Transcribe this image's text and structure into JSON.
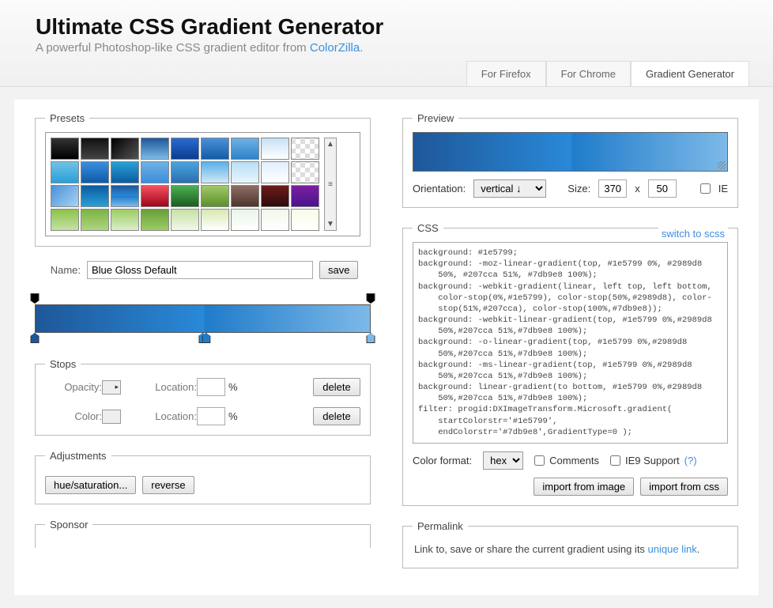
{
  "header": {
    "title": "Ultimate CSS Gradient Generator",
    "tagline_prefix": "A powerful Photoshop-like CSS gradient editor from ",
    "tagline_link": "ColorZilla",
    "tagline_suffix": "."
  },
  "tabs": [
    {
      "label": "For Firefox",
      "active": false
    },
    {
      "label": "For Chrome",
      "active": false
    },
    {
      "label": "Gradient Generator",
      "active": true
    }
  ],
  "presets": {
    "legend": "Presets",
    "swatches": [
      "linear-gradient(#333,#000)",
      "linear-gradient(#111,#444)",
      "linear-gradient(135deg,#000,#555)",
      "linear-gradient(#1e5799,#7db9e8)",
      "linear-gradient(#2b6bd1,#0a3c8f)",
      "linear-gradient(#4a90d9,#145ca8)",
      "linear-gradient(#6fb1e4,#2c82c9)",
      "linear-gradient(#c7e0f4,#fff)",
      "repeating-conic-gradient(#ddd 0 25%,#fff 0 50%) 50%/12px 12px",
      "linear-gradient(#6ec2e8,#2a9fd6)",
      "linear-gradient(#3b8ede,#0d5aa7)",
      "linear-gradient(#2a9fd6,#0b5c9e)",
      "linear-gradient(#6fb1e4,#3b8ede)",
      "linear-gradient(#4aa3df,#2a6fb0)",
      "linear-gradient(#5bb0e8,#cfe7f7)",
      "linear-gradient(#b8dff5,#e9f4fb)",
      "linear-gradient(#e0eefc,#fff)",
      "repeating-conic-gradient(#ddd 0 25%,#fff 0 50%) 50%/12px 12px",
      "linear-gradient(135deg,#4a90d9,#a7d3f2)",
      "linear-gradient(#0b5c9e,#2a9fd6)",
      "linear-gradient(#1e5799,#2989d8 50%,#207cca 51%,#7db9e8)",
      "linear-gradient(#f5515f,#9f041b)",
      "linear-gradient(#4caf50,#1b5e20)",
      "linear-gradient(#a0c96a,#5c8f2b)",
      "linear-gradient(#8d6e63,#4e342e)",
      "linear-gradient(#6d1b1b,#2e0b0b)",
      "linear-gradient(#7b1fa2,#4a148c)",
      "linear-gradient(#8bc34a,#c5e1a5)",
      "linear-gradient(#7cb342,#aed581)",
      "linear-gradient(#9ccc65,#dcedc8)",
      "linear-gradient(#689f38,#9ccc65)",
      "linear-gradient(#c5e1a5,#f1f8e9)",
      "linear-gradient(#d7e8b0,#fff)",
      "linear-gradient(#e8f5e9,#fff)",
      "linear-gradient(#f1f8e9,#fff)",
      "linear-gradient(#f9fbe7,#fff)"
    ]
  },
  "name": {
    "label": "Name:",
    "value": "Blue Gloss Default",
    "save": "save"
  },
  "editor": {
    "opacity_stops": [
      0,
      100
    ],
    "color_stops": [
      {
        "pos": 0,
        "color": "#1e5799"
      },
      {
        "pos": 50,
        "color": "#2989d8"
      },
      {
        "pos": 51,
        "color": "#207cca"
      },
      {
        "pos": 100,
        "color": "#7db9e8"
      }
    ]
  },
  "stops": {
    "legend": "Stops",
    "opacity_label": "Opacity:",
    "color_label": "Color:",
    "location_label": "Location:",
    "pct": "%",
    "delete": "delete"
  },
  "adjustments": {
    "legend": "Adjustments",
    "hue_sat": "hue/saturation...",
    "reverse": "reverse"
  },
  "sponsor": {
    "legend": "Sponsor"
  },
  "preview": {
    "legend": "Preview",
    "orientation_label": "Orientation:",
    "orientation_value": "vertical ↓",
    "size_label": "Size:",
    "width": "370",
    "x": "x",
    "height": "50",
    "ie_label": "IE"
  },
  "css": {
    "legend": "CSS",
    "switch_link": "switch to scss",
    "code": "background: #1e5799;\nbackground: -moz-linear-gradient(top, #1e5799 0%, #2989d8\n    50%, #207cca 51%, #7db9e8 100%);\nbackground: -webkit-gradient(linear, left top, left bottom,\n    color-stop(0%,#1e5799), color-stop(50%,#2989d8), color-\n    stop(51%,#207cca), color-stop(100%,#7db9e8));\nbackground: -webkit-linear-gradient(top, #1e5799 0%,#2989d8\n    50%,#207cca 51%,#7db9e8 100%);\nbackground: -o-linear-gradient(top, #1e5799 0%,#2989d8\n    50%,#207cca 51%,#7db9e8 100%);\nbackground: -ms-linear-gradient(top, #1e5799 0%,#2989d8\n    50%,#207cca 51%,#7db9e8 100%);\nbackground: linear-gradient(to bottom, #1e5799 0%,#2989d8\n    50%,#207cca 51%,#7db9e8 100%);\nfilter: progid:DXImageTransform.Microsoft.gradient(\n    startColorstr='#1e5799',\n    endColorstr='#7db9e8',GradientType=0 );",
    "format_label": "Color format:",
    "format_value": "hex",
    "comments_label": "Comments",
    "ie9_label": "IE9 Support",
    "help": "(?)",
    "import_image": "import from image",
    "import_css": "import from css"
  },
  "permalink": {
    "legend": "Permalink",
    "text_prefix": "Link to, save or share the current gradient using its ",
    "link": "unique link",
    "text_suffix": "."
  }
}
